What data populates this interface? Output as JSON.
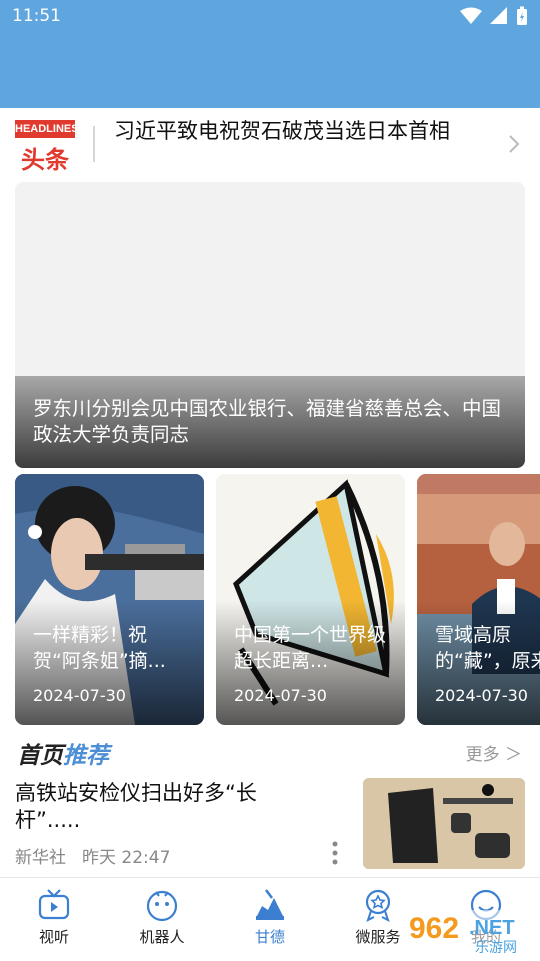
{
  "status_bar": {
    "time": "11:51"
  },
  "headline": {
    "logo_en": "HEADLINES",
    "logo_cn": "头条",
    "text": "习近平致电祝贺石破茂当选日本首相"
  },
  "banner": {
    "caption": "罗东川分别会见中国农业银行、福建省慈善总会、中国政法大学负责同志"
  },
  "cards": [
    {
      "title": "一样精彩！祝贺“阿条姐”摘...",
      "date": "2024-07-30"
    },
    {
      "title": "中国第一个世界级超长距离...",
      "date": "2024-07-30"
    },
    {
      "title": "雪域高原的“藏”，原来",
      "date": "2024-07-30"
    }
  ],
  "section": {
    "title_a": "首页",
    "title_b": "推荐",
    "more": "更多 ＞"
  },
  "news": {
    "title": "高铁站安检仪扫出好多“长杆”.....",
    "source": "新华社",
    "time": "昨天  22:47"
  },
  "nav": [
    {
      "label": "视听",
      "icon": "tv-icon"
    },
    {
      "label": "机器人",
      "icon": "robot-icon"
    },
    {
      "label": "甘德",
      "icon": "gande-icon"
    },
    {
      "label": "微服务",
      "icon": "service-badge-icon"
    },
    {
      "label": "我的",
      "icon": "profile-icon"
    }
  ],
  "watermark": {
    "brand": "962.NET",
    "sub": "乐游网"
  },
  "colors": {
    "header_blue": "#5fa5de",
    "accent_blue": "#3c7fd0",
    "headline_red": "#e03a2f"
  }
}
